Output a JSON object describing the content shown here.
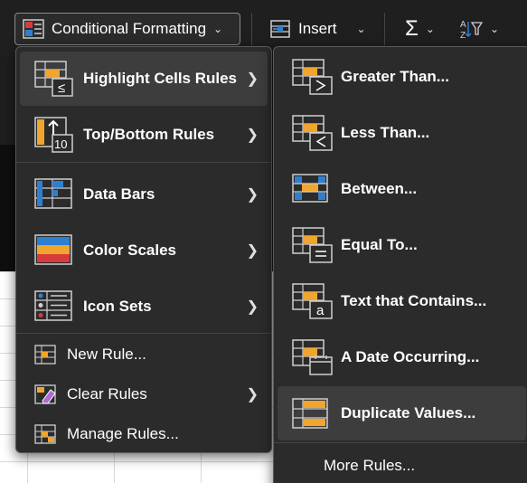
{
  "ribbon": {
    "conditional_formatting_label": "Conditional Formatting",
    "insert_label": "Insert",
    "sum_symbol": "Σ",
    "sort_label": "AZ"
  },
  "main_menu": {
    "items": [
      {
        "label": "Highlight Cells Rules",
        "icon": "highlight-cells-icon",
        "has_submenu": true,
        "active": true
      },
      {
        "label": "Top/Bottom Rules",
        "icon": "top-bottom-icon",
        "has_submenu": true
      },
      {
        "label": "Data Bars",
        "icon": "data-bars-icon",
        "has_submenu": true
      },
      {
        "label": "Color Scales",
        "icon": "color-scales-icon",
        "has_submenu": true
      },
      {
        "label": "Icon Sets",
        "icon": "icon-sets-icon",
        "has_submenu": true
      }
    ],
    "footer_items": [
      {
        "label": "New Rule...",
        "icon": "new-rule-icon"
      },
      {
        "label": "Clear Rules",
        "icon": "clear-rules-icon",
        "has_submenu": true
      },
      {
        "label": "Manage Rules...",
        "icon": "manage-rules-icon"
      }
    ],
    "top_bottom_badge": "10"
  },
  "sub_menu": {
    "items": [
      {
        "label": "Greater Than...",
        "icon": "greater-than-icon"
      },
      {
        "label": "Less Than...",
        "icon": "less-than-icon"
      },
      {
        "label": "Between...",
        "icon": "between-icon"
      },
      {
        "label": "Equal To...",
        "icon": "equal-to-icon"
      },
      {
        "label": "Text that Contains...",
        "icon": "text-contains-icon"
      },
      {
        "label": "A Date Occurring...",
        "icon": "date-occurring-icon"
      },
      {
        "label": "Duplicate Values...",
        "icon": "duplicate-values-icon",
        "active": true
      }
    ],
    "more_rules": "More Rules..."
  },
  "colors": {
    "orange": "#f0a52e",
    "blue": "#2f7fd1",
    "red": "#d83b3b",
    "menu_bg": "#2b2b2b",
    "hover_bg": "#3d3d3d"
  }
}
